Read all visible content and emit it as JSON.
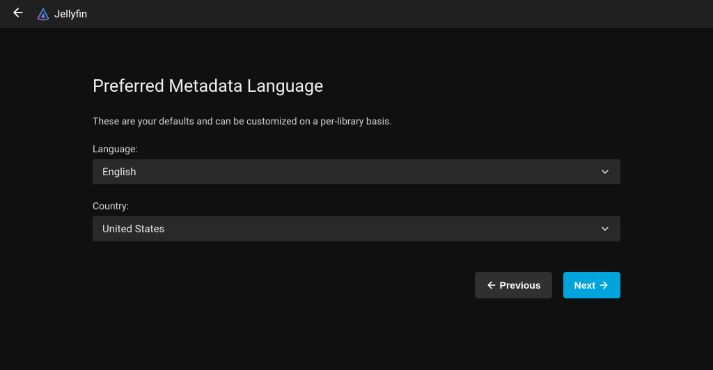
{
  "header": {
    "brand_name": "Jellyfin"
  },
  "page": {
    "title": "Preferred Metadata Language",
    "subtitle": "These are your defaults and can be customized on a per-library basis."
  },
  "fields": {
    "language": {
      "label": "Language:",
      "value": "English"
    },
    "country": {
      "label": "Country:",
      "value": "United States"
    }
  },
  "buttons": {
    "previous": "Previous",
    "next": "Next"
  },
  "colors": {
    "accent": "#00a4dc",
    "header_bg": "#202020",
    "body_bg": "#101010",
    "input_bg": "#292929"
  }
}
